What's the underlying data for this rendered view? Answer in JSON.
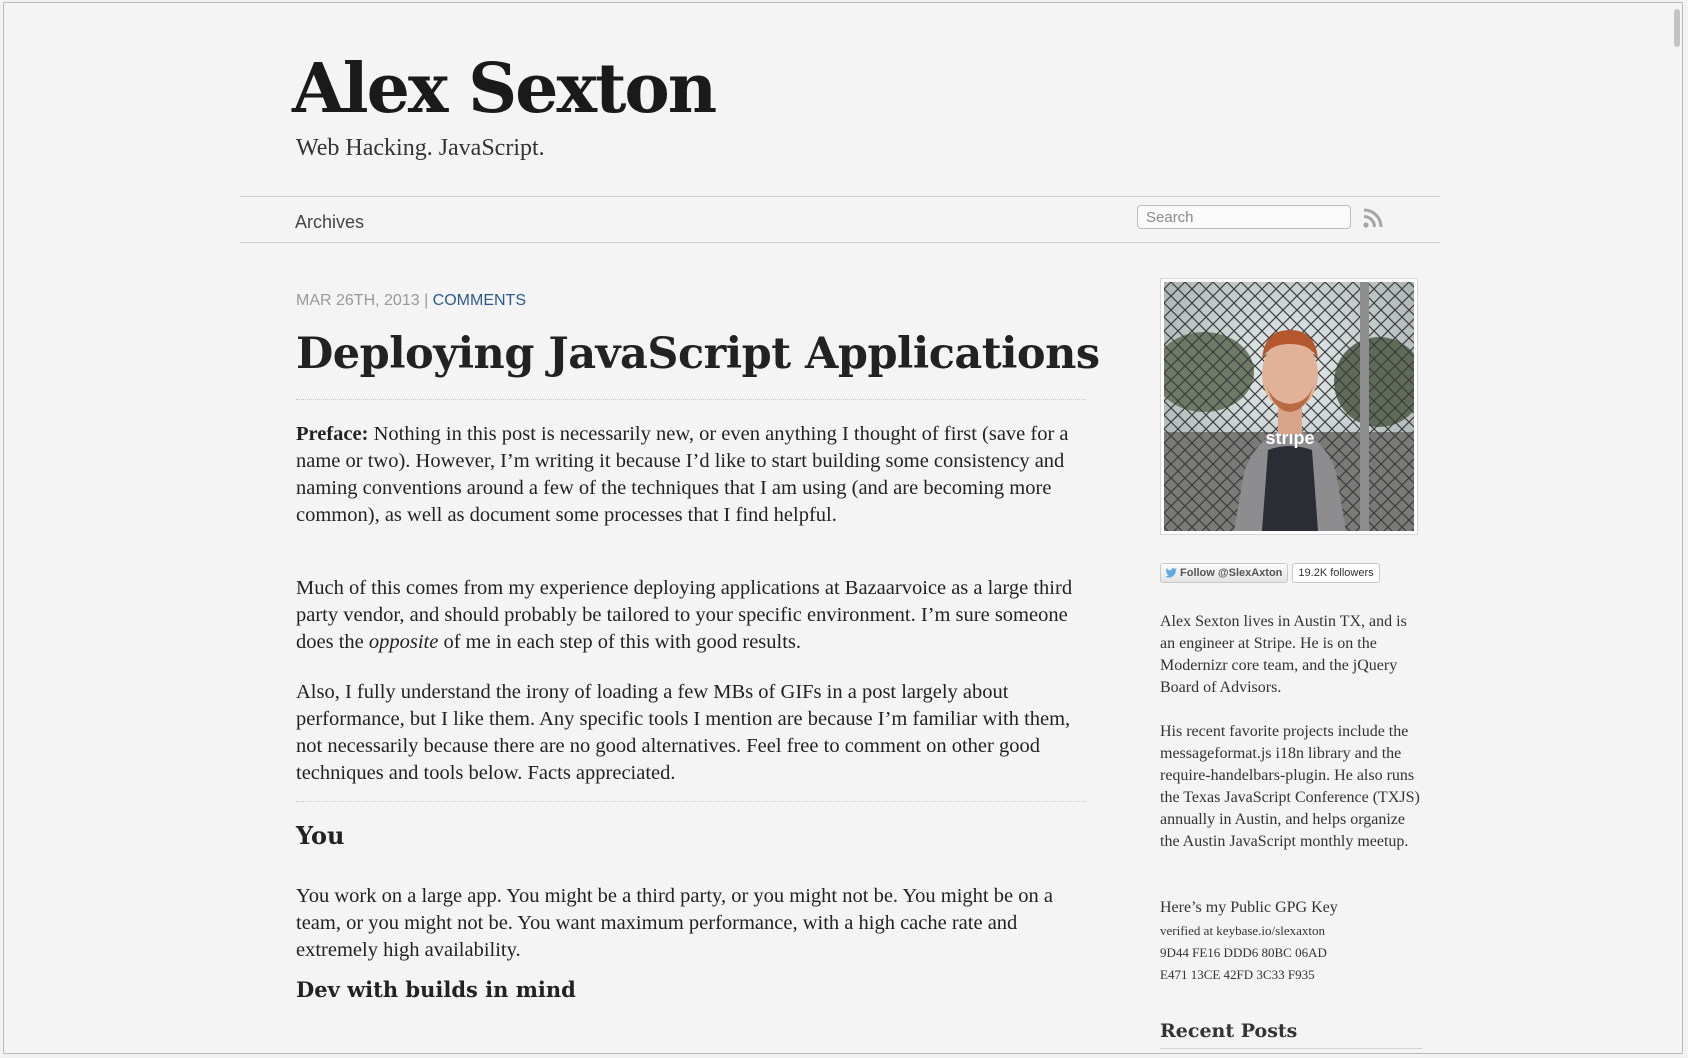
{
  "site": {
    "title": "Alex Sexton",
    "tagline": "Web Hacking. JavaScript."
  },
  "nav": {
    "archives": "Archives",
    "search_placeholder": "Search",
    "rss_icon": "rss-icon"
  },
  "post": {
    "date": "Mar 26th, 2013",
    "separator": "|",
    "comments_link": "Comments",
    "title": "Deploying JavaScript Applications",
    "preface_label": "Preface:",
    "preface_text": " Nothing in this post is necessarily new, or even anything I thought of first (save for a name or two). However, I’m writing it because I’d like to start building some consistency and naming conventions around a few of the techniques that I am using (and are becoming more common), as well as document some processes that I find helpful.",
    "p2_before": "Much of this comes from my experience deploying applications at Bazaarvoice as a large third party vendor, and should probably be tailored to your specific environment. I’m sure someone does the ",
    "p2_em": "opposite",
    "p2_after": " of me in each step of this with good results.",
    "p3": "Also, I fully understand the irony of loading a few MBs of GIFs in a post largely about performance, but I like them. Any specific tools I mention are because I’m familiar with them, not necessarily because there are no good alternatives. Feel free to comment on other good techniques and tools below. Facts appreciated.",
    "h_you": "You",
    "p_you": "You work on a large app. You might be a third party, or you might not be. You might be on a team, or you might not be. You want maximum performance, with a high cache rate and extremely high availability.",
    "h_dev": "Dev with builds in mind"
  },
  "sidebar": {
    "shirt_text": "stripe",
    "follow_button": "Follow @SlexAxton",
    "followers": "19.2K followers",
    "bio": "Alex Sexton lives in Austin TX, and is an engineer at Stripe. He is on the Modernizr core team, and the jQuery Board of Advisors.",
    "projects": "His recent favorite projects include the messageformat.js i18n library and the require-handelbars-plugin. He also runs the Texas JavaScript Conference (TXJS) annually in Austin, and helps organize the Austin JavaScript monthly meetup.",
    "gpg_label": "Here’s my Public GPG Key",
    "gpg_verified": "verified at keybase.io/slexaxton",
    "gpg_line1": "9D44 FE16 DDD6 80BC 06AD",
    "gpg_line2": "E471 13CE 42FD 3C33 F935",
    "recent_posts": "Recent Posts"
  }
}
